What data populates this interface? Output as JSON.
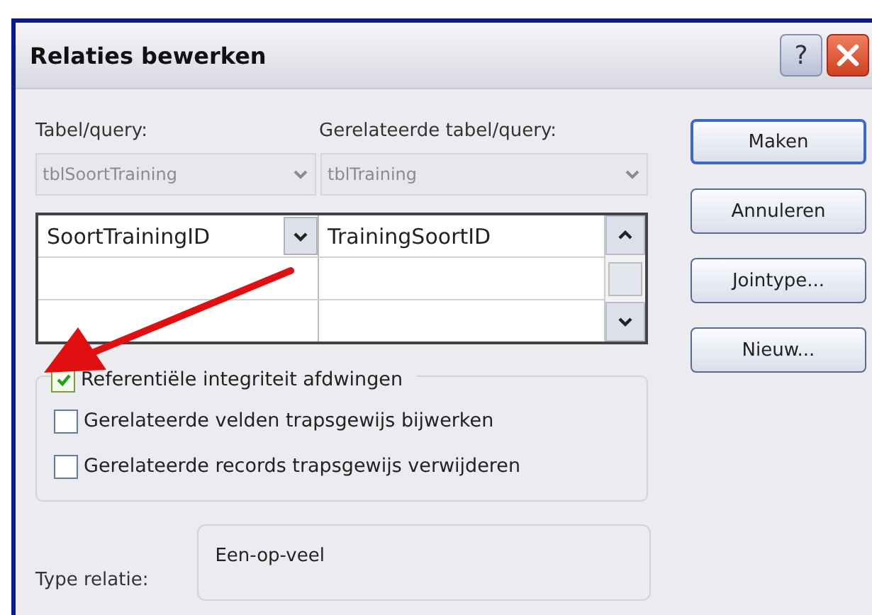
{
  "window": {
    "title": "Relaties bewerken",
    "help": "?"
  },
  "tables": {
    "source_label": "Tabel/query:",
    "related_label": "Gerelateerde tabel/query:",
    "source_value": "tblSoortTraining",
    "related_value": "tblTraining",
    "disabled": true
  },
  "grid": {
    "rows": [
      {
        "field": "SoortTrainingID",
        "related_field": "TrainingSoortID"
      }
    ]
  },
  "options": [
    {
      "label": "Referentiële integriteit afdwingen",
      "checked": true
    },
    {
      "label": "Gerelateerde velden trapsgewijs bijwerken",
      "checked": false
    },
    {
      "label": "Gerelateerde records trapsgewijs verwijderen",
      "checked": false
    }
  ],
  "relation": {
    "label": "Type relatie:",
    "value": "Een-op-veel"
  },
  "buttons": [
    {
      "label": "Maken",
      "default": true
    },
    {
      "label": "Annuleren",
      "default": false
    },
    {
      "label": "Jointype...",
      "default": false
    },
    {
      "label": "Nieuw...",
      "default": false
    }
  ]
}
